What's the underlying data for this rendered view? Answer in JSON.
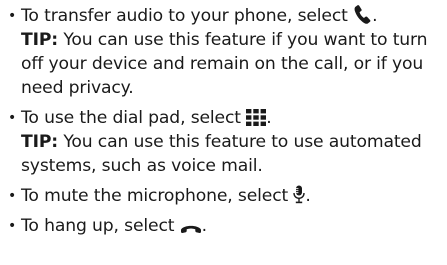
{
  "items": [
    {
      "text_before": "To transfer audio to your phone, select ",
      "icon": "phone-handset-icon",
      "text_after": ".",
      "tip_label": "TIP:",
      "tip_text": " You can use this feature if you want to turn off your device and remain on the call, or if you need privacy."
    },
    {
      "text_before": "To use the dial pad, select ",
      "icon": "dial-pad-icon",
      "text_after": ".",
      "tip_label": "TIP:",
      "tip_text": " You can use this feature to use automated systems, such as voice mail."
    },
    {
      "text_before": "To mute the microphone, select ",
      "icon": "microphone-icon",
      "text_after": "."
    },
    {
      "text_before": "To hang up, select ",
      "icon": "hang-up-icon",
      "text_after": "."
    }
  ],
  "bullet": "•",
  "text_color": "#1a1a1a"
}
